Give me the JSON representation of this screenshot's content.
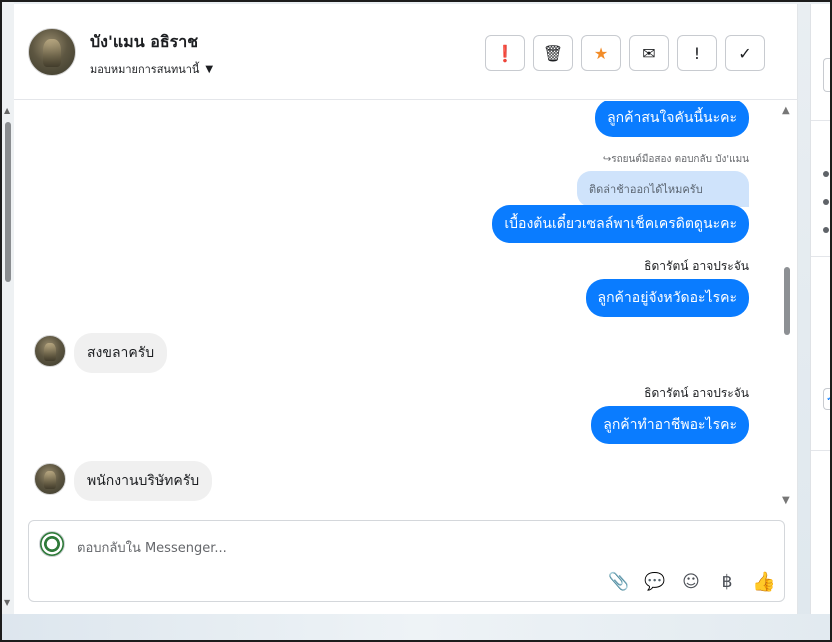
{
  "header": {
    "contact_name": "บัง'แมน อธิราช",
    "assign_label": "มอบหมายการสนทนานี้",
    "toolbar": [
      {
        "name": "spam-button",
        "icon": "alert-circle-icon",
        "glyph": "❗"
      },
      {
        "name": "delete-button",
        "icon": "trash-icon",
        "glyph": "🗑"
      },
      {
        "name": "star-button",
        "icon": "star-icon",
        "glyph": "★"
      },
      {
        "name": "mark-unread-button",
        "icon": "envelope-icon",
        "glyph": "✉"
      },
      {
        "name": "follow-up-button",
        "icon": "exclamation-icon",
        "glyph": "!"
      },
      {
        "name": "mark-done-button",
        "icon": "check-icon",
        "glyph": "✓"
      }
    ]
  },
  "messages": [
    {
      "type": "out",
      "text": "ลูกค้าสนใจคันนี้นะคะ"
    },
    {
      "type": "reply_meta",
      "text": "รถยนต์มือสอง ตอบกลับ บัง'แมน"
    },
    {
      "type": "quoted",
      "text": "ติดล่าช้าออกได้ไหมครับ"
    },
    {
      "type": "out",
      "text": "เบื้องต้นเดี๋ยวเซลล์พาเช็คเครดิตดูนะคะ"
    },
    {
      "type": "sender",
      "text": "ธิดารัตน์ อาจประจัน"
    },
    {
      "type": "out",
      "text": "ลูกค้าอยู่จังหวัดอะไรคะ"
    },
    {
      "type": "in",
      "text": "สงขลาครับ"
    },
    {
      "type": "sender",
      "text": "ธิดารัตน์ อาจประจัน"
    },
    {
      "type": "out",
      "text": "ลูกค้าทำอาชีพอะไรคะ"
    },
    {
      "type": "in",
      "text": "พนักงานบริษัทครับ"
    }
  ],
  "composer": {
    "placeholder": "ตอบกลับใน Messenger...",
    "icons": [
      {
        "name": "attach-icon",
        "glyph": "📎"
      },
      {
        "name": "saved-replies-icon",
        "glyph": "💬"
      },
      {
        "name": "emoji-icon",
        "glyph": "☺"
      },
      {
        "name": "payment-icon",
        "glyph": "฿"
      },
      {
        "name": "like-icon",
        "glyph": "👍"
      }
    ]
  },
  "colors": {
    "accent": "#0a7cff",
    "incoming_bubble": "#f0f0f0",
    "quoted_bubble": "#cfe3fb",
    "star": "#f28c28"
  }
}
